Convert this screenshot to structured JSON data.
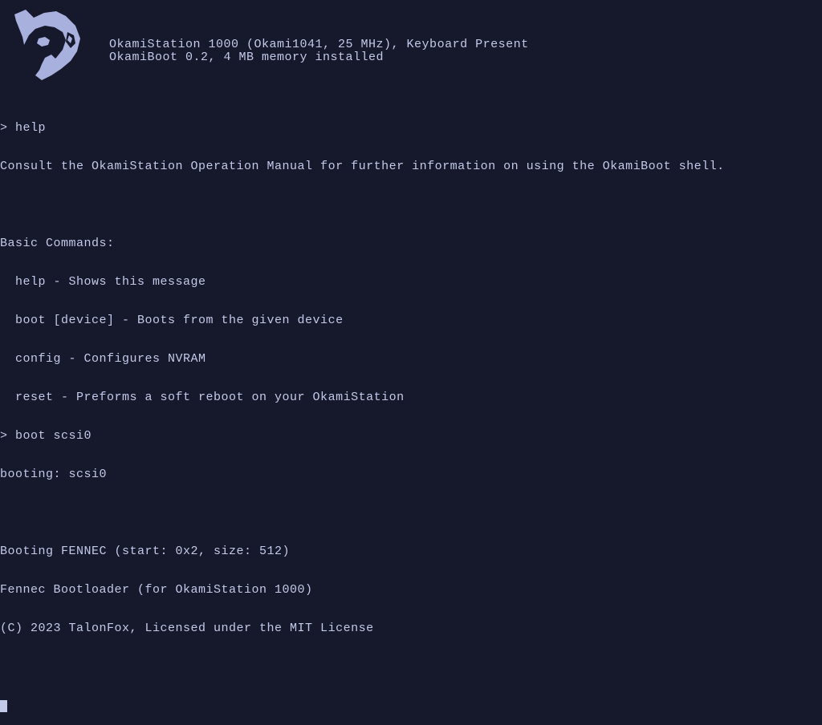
{
  "header": {
    "line1": "OkamiStation 1000 (Okami1041, 25 MHz), Keyboard Present",
    "line2": "OkamiBoot 0.2, 4 MB memory installed"
  },
  "lines": [
    "> help",
    "Consult the OkamiStation Operation Manual for further information on using the OkamiBoot shell.",
    "",
    "Basic Commands:",
    "  help - Shows this message",
    "  boot [device] - Boots from the given device",
    "  config - Configures NVRAM",
    "  reset - Preforms a soft reboot on your OkamiStation",
    "> boot scsi0",
    "booting: scsi0",
    "",
    "Booting FENNEC (start: 0x2, size: 512)",
    "Fennec Bootloader (for OkamiStation 1000)",
    "(C) 2023 TalonFox, Licensed under the MIT License",
    ""
  ]
}
